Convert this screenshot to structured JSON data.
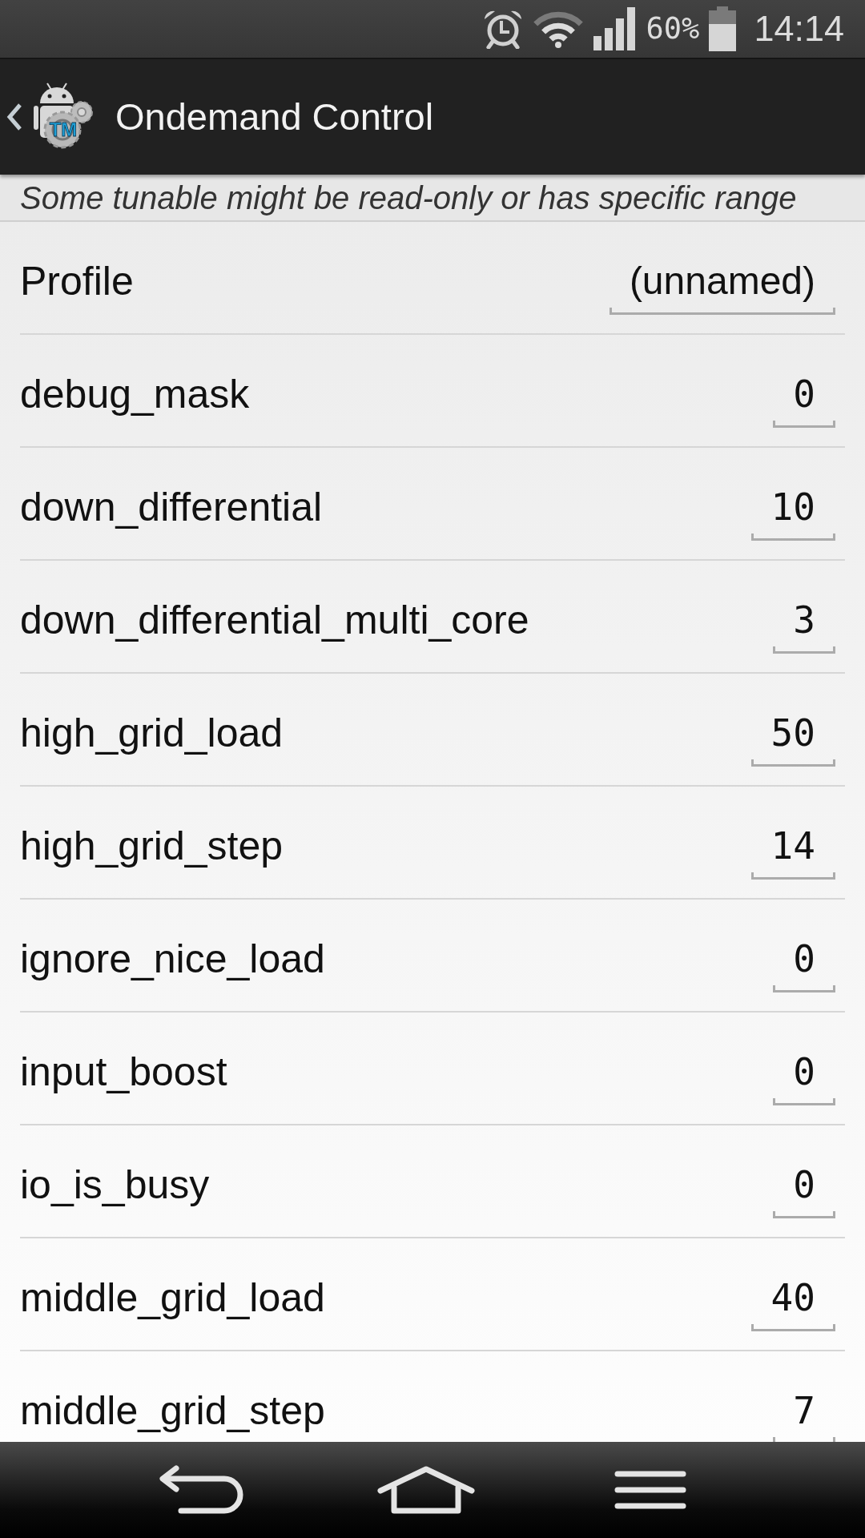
{
  "status_bar": {
    "battery_text": "60%",
    "time": "14:14"
  },
  "action_bar": {
    "title": "Ondemand Control",
    "logo_text": "TM"
  },
  "notice": "Some tunable might be read-only or has specific range",
  "rows": [
    {
      "label": "Profile",
      "value": "(unnamed)"
    },
    {
      "label": "debug_mask",
      "value": "0"
    },
    {
      "label": "down_differential",
      "value": "10"
    },
    {
      "label": "down_differential_multi_core",
      "value": "3"
    },
    {
      "label": "high_grid_load",
      "value": "50"
    },
    {
      "label": "high_grid_step",
      "value": "14"
    },
    {
      "label": "ignore_nice_load",
      "value": "0"
    },
    {
      "label": "input_boost",
      "value": "0"
    },
    {
      "label": "io_is_busy",
      "value": "0"
    },
    {
      "label": "middle_grid_load",
      "value": "40"
    },
    {
      "label": "middle_grid_step",
      "value": "7"
    }
  ]
}
